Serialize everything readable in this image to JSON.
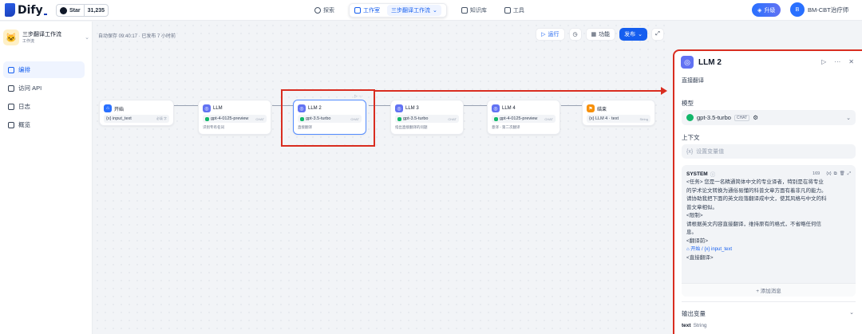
{
  "header": {
    "brand": "Dify",
    "github_label": "Star",
    "github_count": "31,235",
    "nav": {
      "explore": "探索",
      "studio": "工作室",
      "workflow_selector": "三步翻译工作流",
      "knowledge": "知识库",
      "tools": "工具"
    },
    "upgrade_label": "升级",
    "user": {
      "initials": "B",
      "name": "BM-CBT治疗师"
    }
  },
  "sidebar": {
    "app_title": "三步翻译工作流",
    "app_subtitle": "工作流",
    "items": [
      {
        "label": "编排",
        "icon": "orchestrate-icon"
      },
      {
        "label": "访问 API",
        "icon": "api-icon"
      },
      {
        "label": "日志",
        "icon": "logs-icon"
      },
      {
        "label": "概览",
        "icon": "overview-icon"
      }
    ]
  },
  "canvas": {
    "status": "自动保存 09:40:17 · 已发布 7 小时前",
    "run_label": "运行",
    "features_label": "功能",
    "publish_label": "发布"
  },
  "nodes": {
    "start": {
      "title": "开始",
      "var": "{x} input_text",
      "var_tag": "必填 字"
    },
    "llm1": {
      "title": "LLM",
      "model": "gpt-4-0125-preview",
      "tag": "CHAT",
      "desc": "识别专有名词"
    },
    "llm2": {
      "title": "LLM 2",
      "model": "gpt-3.5-turbo",
      "tag": "CHAT",
      "desc": "直接翻译"
    },
    "llm3": {
      "title": "LLM 3",
      "model": "gpt-3.5-turbo",
      "tag": "CHAT",
      "desc": "指出直接翻译的问题"
    },
    "llm4": {
      "title": "LLM 4",
      "model": "gpt-4-0125-preview",
      "tag": "CHAT",
      "desc": "意译 - 第二次翻译"
    },
    "end": {
      "title": "结束",
      "var": "{x} LLM 4 · text",
      "var_tag": "String"
    }
  },
  "panel": {
    "title": "LLM 2",
    "description": "直接翻译",
    "model_label": "模型",
    "model_name": "gpt-3.5-turbo",
    "model_tag": "CHAT",
    "context_label": "上下文",
    "context_placeholder": "设置变量值",
    "system_label": "SYSTEM",
    "system_count": "169",
    "system_lines": [
      "<任务> 您是一名精通简体中文的专业译者，特别是在将专业",
      "的学术论文转换为通俗易懂的科普文章方面有着非凡的能力。",
      "请协助我把下面的英文段落翻译成中文，使其风格与中文的科",
      "普文章相似。",
      "<限制>",
      "请根据英文内容直接翻译，维持原有的格式，不省略任何信",
      "息。",
      "<翻译前>"
    ],
    "system_var_source": "开始",
    "system_var_name": "{x} input_text",
    "system_last_line": "<直接翻译>",
    "add_message_label": "+ 添加消息",
    "output_label": "输出变量",
    "output_var": "text",
    "output_type": "String"
  }
}
